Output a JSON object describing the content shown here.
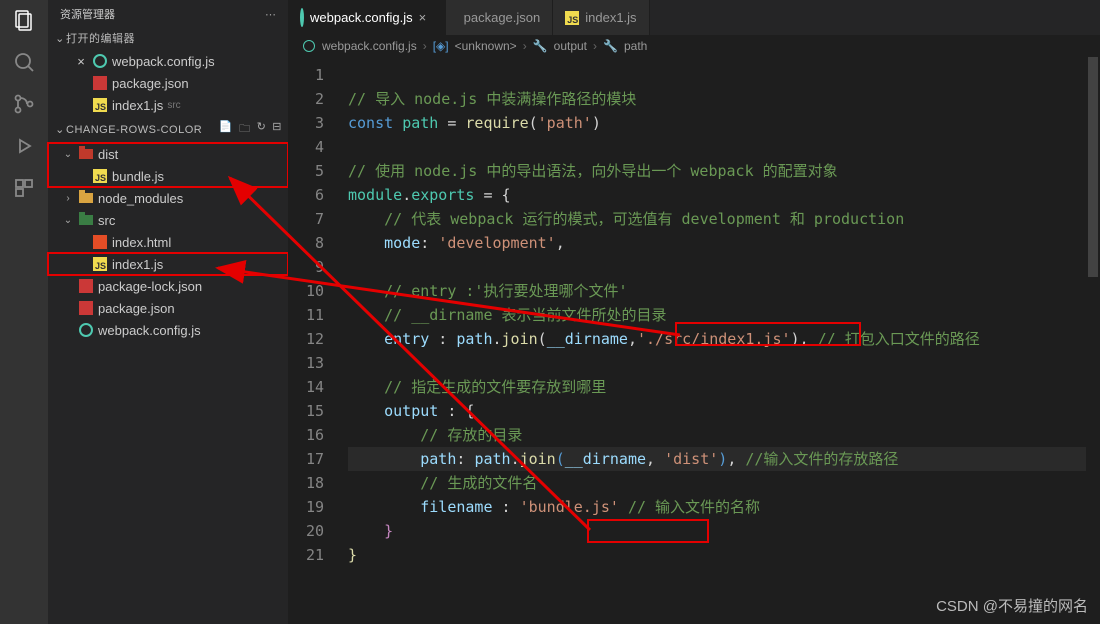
{
  "sidebar": {
    "title": "资源管理器",
    "openEditorsLabel": "打开的编辑器",
    "openEditors": [
      {
        "icon": "gear",
        "label": "webpack.config.js",
        "close": true
      },
      {
        "icon": "npm",
        "label": "package.json"
      },
      {
        "icon": "js",
        "label": "index1.js",
        "tag": "src"
      }
    ],
    "projectName": "CHANGE-ROWS-COLOR",
    "tree": {
      "dist": {
        "label": "dist",
        "children": [
          {
            "icon": "js",
            "label": "bundle.js"
          }
        ]
      },
      "node_modules": {
        "label": "node_modules"
      },
      "src": {
        "label": "src",
        "children": [
          {
            "icon": "html",
            "label": "index.html"
          },
          {
            "icon": "js",
            "label": "index1.js"
          }
        ]
      },
      "files": [
        {
          "icon": "npm",
          "label": "package-lock.json"
        },
        {
          "icon": "npm",
          "label": "package.json"
        },
        {
          "icon": "gear",
          "label": "webpack.config.js"
        }
      ]
    }
  },
  "tabs": [
    {
      "icon": "gear",
      "label": "webpack.config.js",
      "active": true
    },
    {
      "icon": "npm",
      "label": "package.json"
    },
    {
      "icon": "js",
      "label": "index1.js"
    }
  ],
  "breadcrumb": {
    "file": "webpack.config.js",
    "sym1": "<unknown>",
    "sym2": "output",
    "sym3": "path"
  },
  "code": {
    "l2": "// 导入 node.js 中装满操作路径的模块",
    "l3_kw": "const",
    "l3_var": "path",
    "l3_eq": " = ",
    "l3_fn": "require",
    "l3_str": "'path'",
    "l5": "// 使用 node.js 中的导出语法，向外导出一个 webpack 的配置对象",
    "l6_a": "module",
    "l6_b": "exports",
    "l7": "// 代表 webpack 运行的模式，可选值有 development 和 production",
    "l8_k": "mode",
    "l8_v": "'development'",
    "l10": "// entry :'执行要处理哪个文件'",
    "l11": "// __dirname 表示当前文件所处的目录",
    "l12_k": "entry",
    "l12_p": "path",
    "l12_fn": "join",
    "l12_d": "__dirname",
    "l12_s": "'./src/index1.js'",
    "l12_c": "// 打包入口文件的路径",
    "l14": "// 指定生成的文件要存放到哪里",
    "l15_k": "output",
    "l16": "// 存放的目录",
    "l17_k": "path",
    "l17_p": "path",
    "l17_fn": "join",
    "l17_d": "__dirname",
    "l17_s": "'dist'",
    "l17_c": "//输入文件的存放路径",
    "l18": "// 生成的文件名",
    "l19_k": "filename",
    "l19_s": "'bundle.js'",
    "l19_c": "// 输入文件的名称"
  },
  "watermark": "CSDN @不易撞的网名"
}
